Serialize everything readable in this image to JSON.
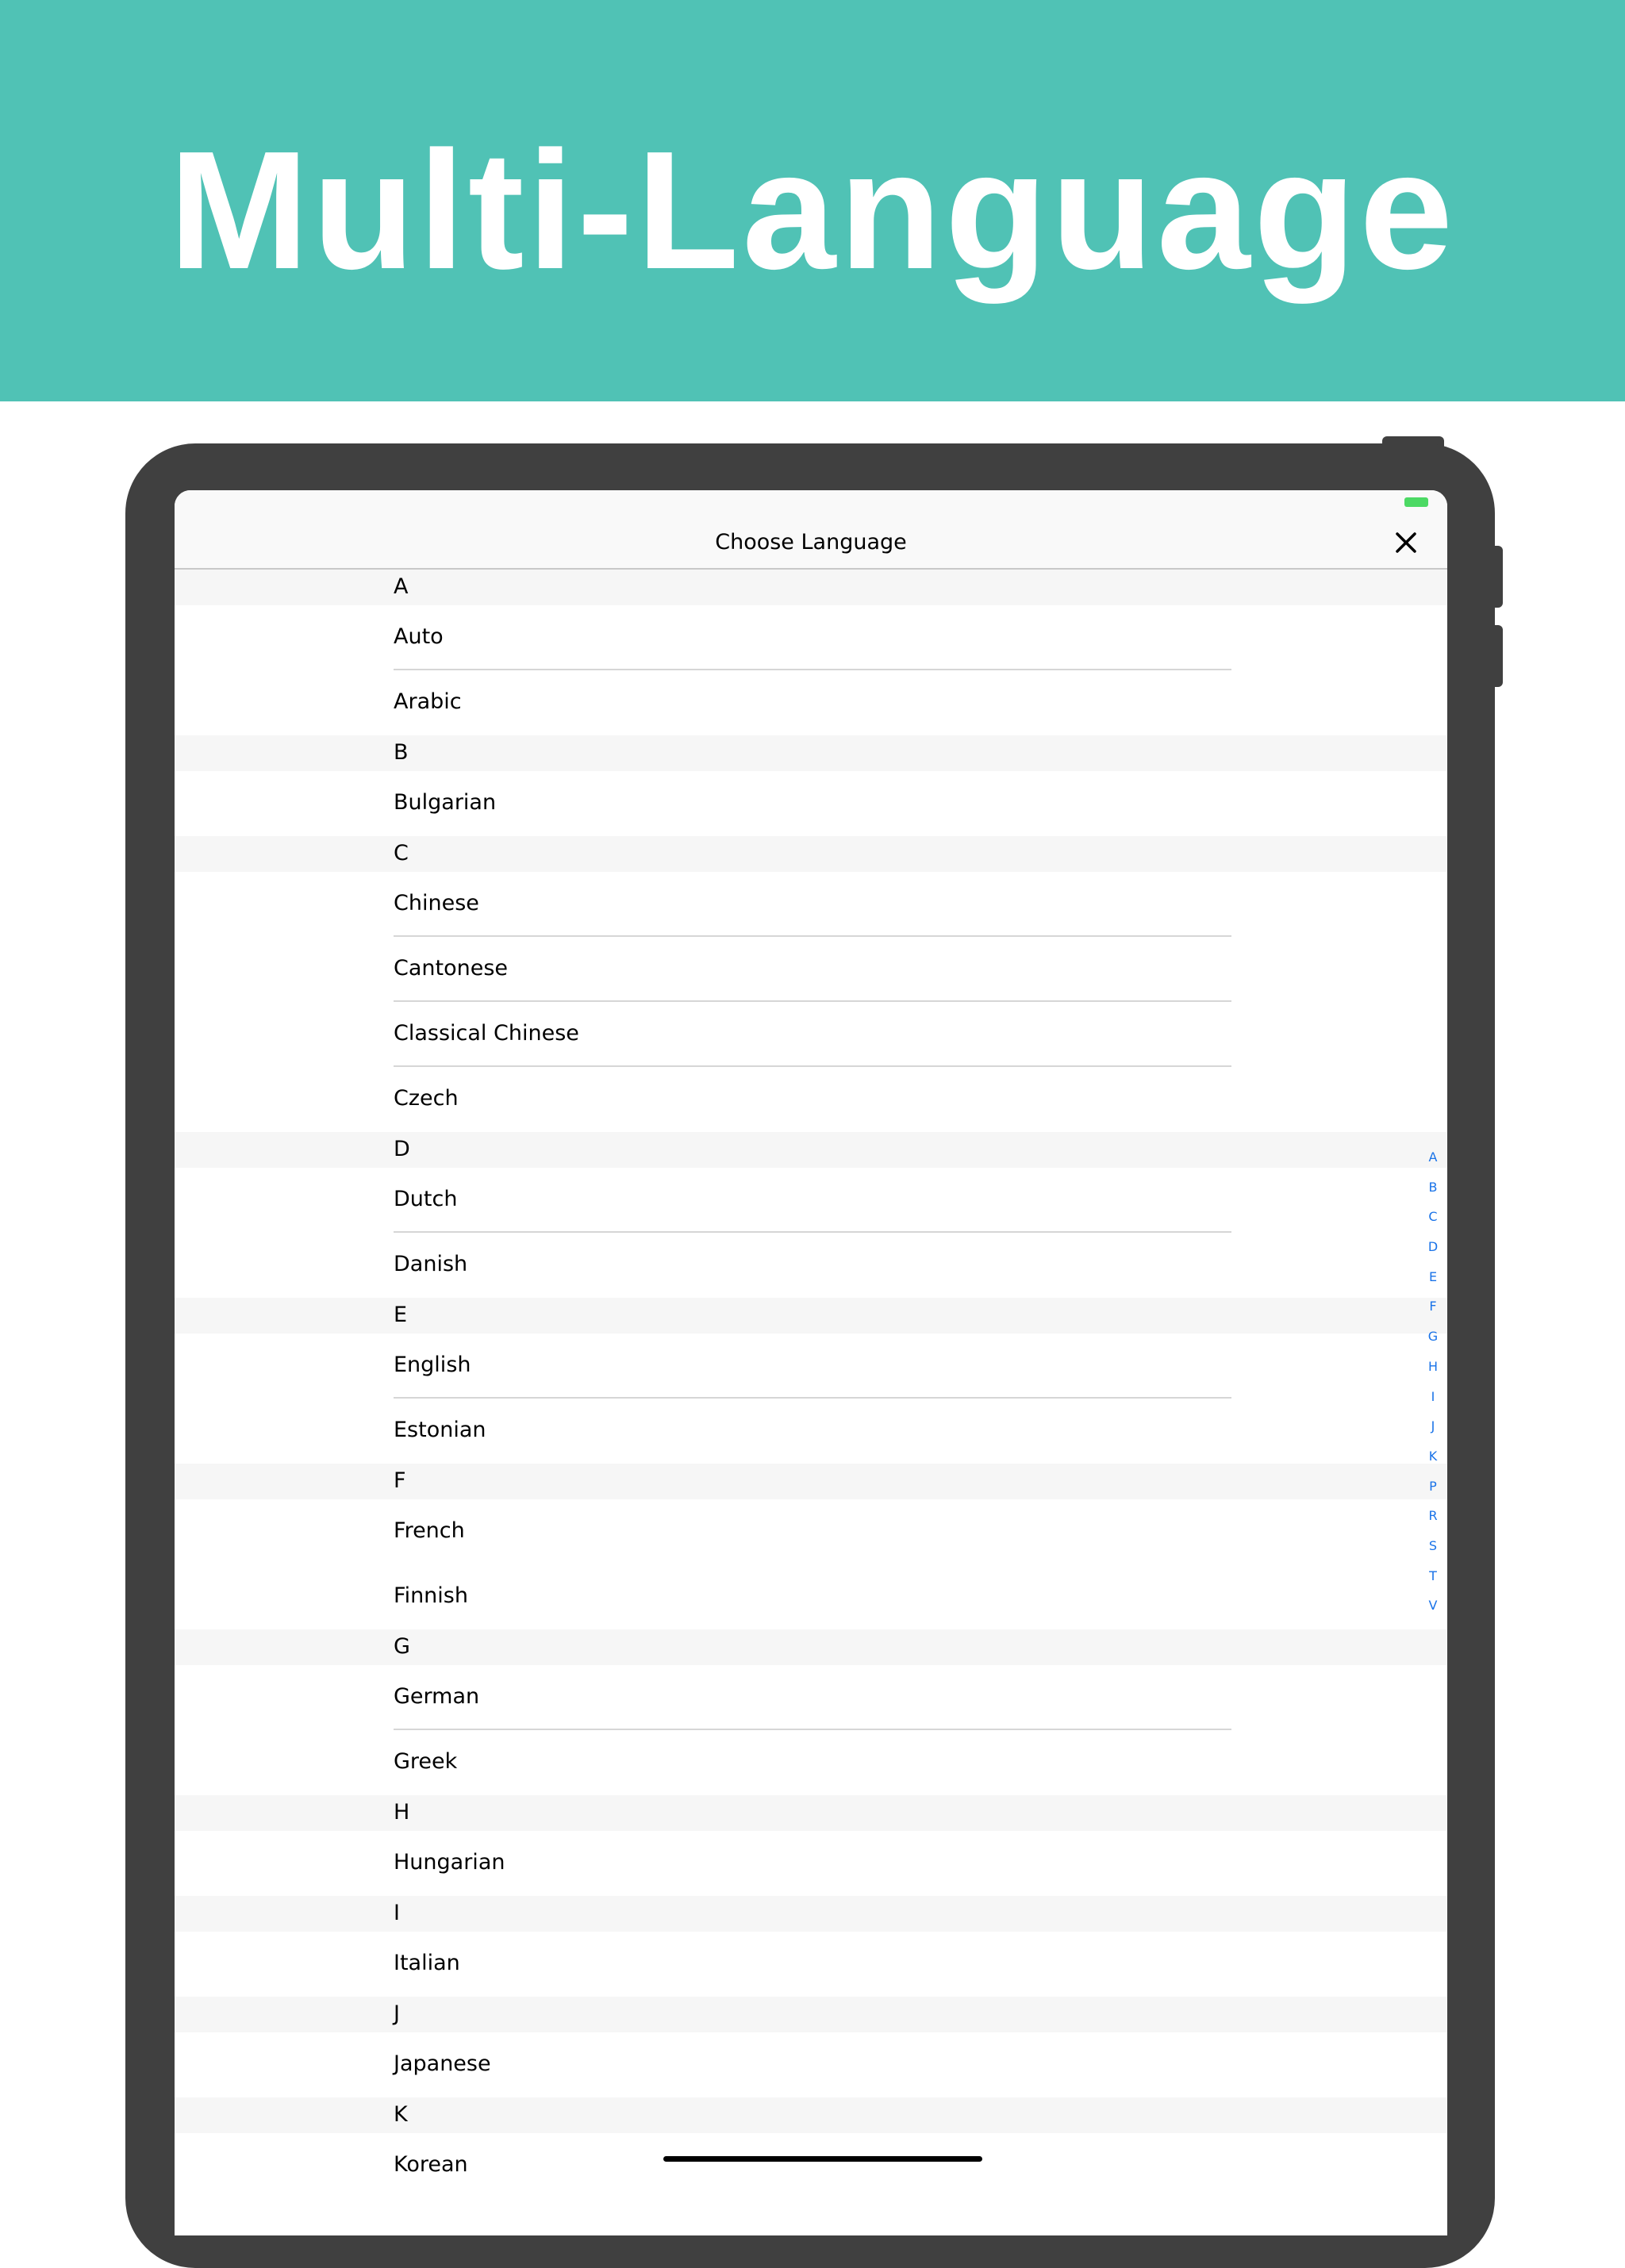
{
  "banner": {
    "title": "Multi-Language"
  },
  "nav": {
    "title": "Choose Language",
    "close_icon": "close-icon"
  },
  "sections": [
    {
      "letter": "A",
      "items": [
        "Auto",
        "Arabic"
      ]
    },
    {
      "letter": "B",
      "items": [
        "Bulgarian"
      ]
    },
    {
      "letter": "C",
      "items": [
        "Chinese",
        "Cantonese",
        "Classical Chinese",
        "Czech"
      ]
    },
    {
      "letter": "D",
      "items": [
        "Dutch",
        "Danish"
      ]
    },
    {
      "letter": "E",
      "items": [
        "English",
        "Estonian"
      ]
    },
    {
      "letter": "F",
      "items": [
        "French",
        "Finnish"
      ]
    },
    {
      "letter": "G",
      "items": [
        "German",
        "Greek"
      ]
    },
    {
      "letter": "H",
      "items": [
        "Hungarian"
      ]
    },
    {
      "letter": "I",
      "items": [
        "Italian"
      ]
    },
    {
      "letter": "J",
      "items": [
        "Japanese"
      ]
    },
    {
      "letter": "K",
      "items": [
        "Korean"
      ]
    }
  ],
  "index_letters": [
    "A",
    "B",
    "C",
    "D",
    "E",
    "F",
    "G",
    "H",
    "I",
    "J",
    "K",
    "P",
    "R",
    "S",
    "T",
    "V"
  ],
  "colors": {
    "banner": "#50c2b5",
    "accent": "#1a73e8",
    "device": "#404040"
  }
}
